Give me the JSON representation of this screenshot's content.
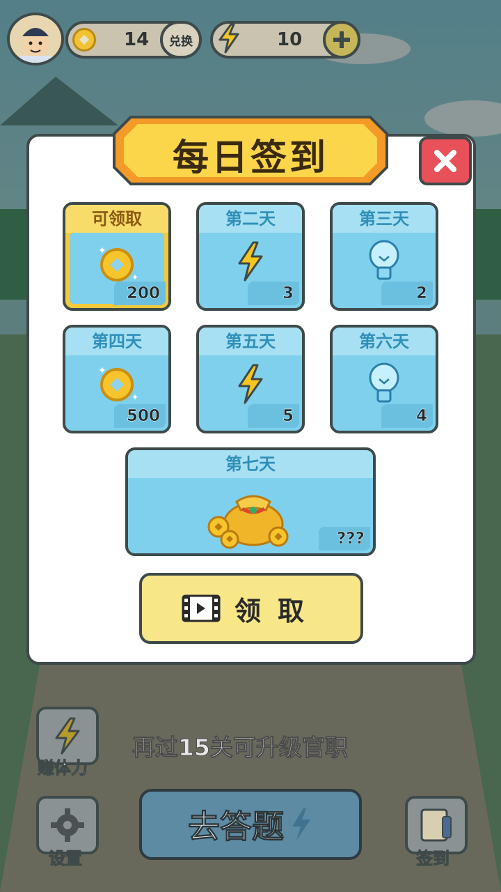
{
  "header": {
    "coins": "14",
    "exchange_label": "兑换",
    "energy": "10"
  },
  "modal": {
    "title": "每日签到",
    "days": [
      {
        "label": "可领取",
        "amount": "200",
        "icon": "coin-icon"
      },
      {
        "label": "第二天",
        "amount": "3",
        "icon": "lightning-icon"
      },
      {
        "label": "第三天",
        "amount": "2",
        "icon": "lightbulb-icon"
      },
      {
        "label": "第四天",
        "amount": "500",
        "icon": "coin-icon"
      },
      {
        "label": "第五天",
        "amount": "5",
        "icon": "lightning-icon"
      },
      {
        "label": "第六天",
        "amount": "4",
        "icon": "lightbulb-icon"
      },
      {
        "label": "第七天",
        "amount": "???",
        "icon": "treasure-bag-icon"
      }
    ],
    "claim_label": "领取"
  },
  "bottom": {
    "earn_energy_label": "赚体力",
    "hint": "再过15关可升级官职",
    "settings_label": "设置",
    "answer_label": "去答题",
    "checkin_label": "签到"
  },
  "colors": {
    "card_blue": "#7fd0ec",
    "card_header_blue": "#a7e0f3",
    "active_yellow": "#f5c93b",
    "close_red": "#e8505a",
    "claim_button": "#f8e789"
  }
}
